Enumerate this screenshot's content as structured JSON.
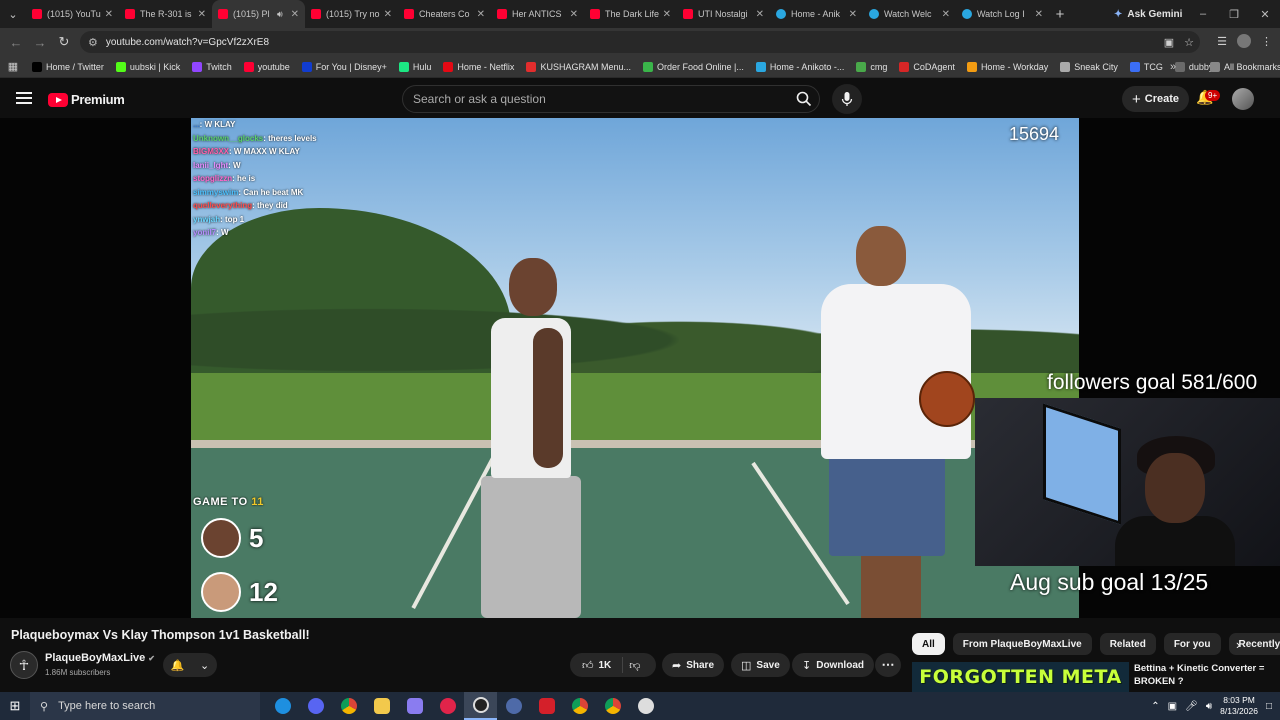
{
  "tabs": [
    {
      "title": "(1015) YouTube",
      "icon": "youtube-favicon",
      "active": false
    },
    {
      "title": "The R-301 is",
      "icon": "youtube-favicon",
      "active": false
    },
    {
      "title": "(1015) Pl",
      "icon": "youtube-favicon",
      "active": true,
      "audio": true
    },
    {
      "title": "(1015) Try no",
      "icon": "youtube-favicon",
      "active": false
    },
    {
      "title": "Cheaters Co",
      "icon": "youtube-favicon",
      "active": false
    },
    {
      "title": "Her ANTICS",
      "icon": "youtube-favicon",
      "active": false
    },
    {
      "title": "The Dark Life",
      "icon": "youtube-favicon",
      "active": false
    },
    {
      "title": "UTI Nostalgi",
      "icon": "youtube-favicon",
      "active": false
    },
    {
      "title": "Home - Anik",
      "icon": "globe-favicon",
      "active": false
    },
    {
      "title": "Watch Welc",
      "icon": "globe-favicon",
      "active": false
    },
    {
      "title": "Watch Log I",
      "icon": "globe-favicon",
      "active": false
    }
  ],
  "browser": {
    "ask_gemini": "Ask Gemini",
    "url": "youtube.com/watch?v=GpcVf2zXrE8"
  },
  "bookmarks": [
    {
      "label": "Home / Twitter",
      "color": "#000000"
    },
    {
      "label": "uubski | Kick",
      "color": "#53fc18"
    },
    {
      "label": "Twitch",
      "color": "#9146ff"
    },
    {
      "label": "youtube",
      "color": "#ff0033"
    },
    {
      "label": "For You | Disney+",
      "color": "#113ccf"
    },
    {
      "label": "Hulu",
      "color": "#1ce783"
    },
    {
      "label": "Home - Netflix",
      "color": "#e50914"
    },
    {
      "label": "KUSHAGRAM Menu...",
      "color": "#e32d2d"
    },
    {
      "label": "Order Food Online |...",
      "color": "#3ab54a"
    },
    {
      "label": "Home - Anikoto -...",
      "color": "#2aa7e0"
    },
    {
      "label": "cmg",
      "color": "#49a94a"
    },
    {
      "label": "CoDAgent",
      "color": "#d62626"
    },
    {
      "label": "Home - Workday",
      "color": "#f39c12"
    },
    {
      "label": "Sneak City",
      "color": "#aaaaaa"
    },
    {
      "label": "TCG",
      "color": "#3b6ef5"
    },
    {
      "label": "dubby",
      "color": "#6a6a6a"
    }
  ],
  "all_bookmarks": "All Bookmarks",
  "youtube": {
    "logo_text": "Premium",
    "search_placeholder": "Search or ask a question",
    "create_label": "Create",
    "notifications_badge": "9+"
  },
  "stream": {
    "viewer_count": "15694",
    "chat": [
      {
        "user": "...",
        "msg": "W KLAY",
        "color": "#3a7bd5"
      },
      {
        "user": "Unknown__glocks",
        "msg": "theres levels",
        "color": "#5bd36b"
      },
      {
        "user": "BIGM3XX",
        "msg": "W MAXX W KLAY",
        "color": "#ff5fa8"
      },
      {
        "user": "lanii_lght",
        "msg": "W",
        "color": "#e68cff"
      },
      {
        "user": "stopglizzn",
        "msg": "he is",
        "color": "#ff66cc"
      },
      {
        "user": "simmyswim",
        "msg": "Can he beat MK",
        "color": "#4cc2ff"
      },
      {
        "user": "quelleverything",
        "msg": "they did",
        "color": "#ff4b4b"
      },
      {
        "user": "ynwjah",
        "msg": "top 1",
        "color": "#6dd6ff"
      },
      {
        "user": "yonil7",
        "msg": "W",
        "color": "#b58cff"
      }
    ],
    "game_to_label": "GAME TO",
    "game_to_value": "11",
    "score_player1": "5",
    "score_player2": "12",
    "followers_goal": "followers goal 581/600",
    "sub_goal": "Aug sub goal 13/25"
  },
  "video": {
    "title": "Plaqueboymax Vs Klay Thompson 1v1 Basketball!",
    "channel": "PlaqueBoyMaxLive",
    "subscribers": "1.86M subscribers",
    "likes": "1K",
    "share": "Share",
    "save": "Save",
    "download": "Download"
  },
  "chips": [
    "All",
    "From PlaqueBoyMaxLive",
    "Related",
    "For you",
    "Recently"
  ],
  "recommendation": {
    "thumbnail_text": "FORGOTTEN META",
    "title": "Bettina + Kinetic Converter = BROKEN ?"
  },
  "taskbar": {
    "search_placeholder": "Type here to search",
    "time": "8:03 PM",
    "date": "8/13/2026"
  }
}
